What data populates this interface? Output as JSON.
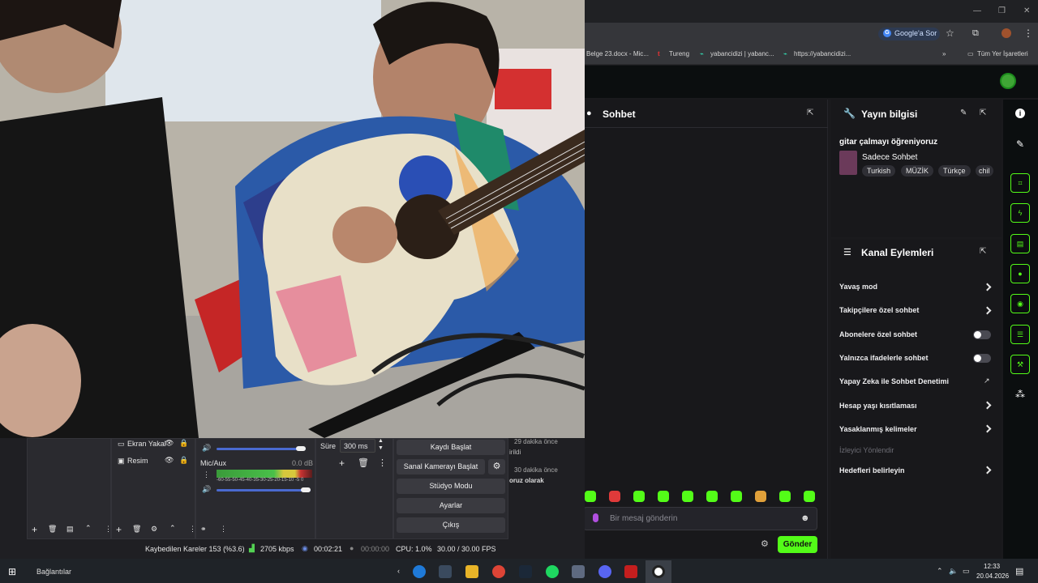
{
  "browser": {
    "google_pill": "Google'a Sor",
    "bookmarks": [
      {
        "label": "Belge 23.docx - Mic..."
      },
      {
        "label": "Tureng"
      },
      {
        "label": "yabancidizi | yabanc..."
      },
      {
        "label": "https://yabancidizi..."
      }
    ],
    "all_bookmarks": "Tüm Yer İşaretleri"
  },
  "chat": {
    "title": "Sohbet",
    "input_placeholder": "Bir mesaj gönderin",
    "send_label": "Gönder"
  },
  "stream_info": {
    "title": "Yayın bilgisi",
    "stream_title": "gitar çalmayı öğreniyoruz",
    "category": "Sadece Sohbet",
    "tags": [
      "Turkish",
      "MÜZİK",
      "Türkçe",
      "chil"
    ]
  },
  "channel_actions": {
    "title": "Kanal Eylemleri",
    "items": [
      {
        "label": "Yavaş mod",
        "control": "chevron"
      },
      {
        "label": "Takipçilere özel sohbet",
        "control": "chevron"
      },
      {
        "label": "Abonelere özel sohbet",
        "control": "toggle"
      },
      {
        "label": "Yalnızca ifadelerle sohbet",
        "control": "toggle"
      },
      {
        "label": "Yapay Zeka ile Sohbet Denetimi",
        "control": "external"
      },
      {
        "label": "Hesap yaşı kısıtlaması",
        "control": "chevron"
      },
      {
        "label": "Yasaklanmış kelimeler",
        "control": "chevron"
      }
    ],
    "section_label": "İzleyici Yönlendir",
    "goals": {
      "label": "Hedefleri belirleyin"
    }
  },
  "obs": {
    "sources": [
      {
        "label": "Ekran Yakal"
      },
      {
        "label": "Resim"
      }
    ],
    "audio": {
      "mic_label": "Mic/Aux",
      "mic_db": "0.0 dB",
      "scale": "-60-55-50-45-40-35-30-25-20-15-10 -5 0"
    },
    "transition": {
      "label": "Süre",
      "value": "300 ms"
    },
    "controls": [
      {
        "label": "Kaydı Başlat"
      },
      {
        "label": "Sanal Kamerayı Başlat"
      },
      {
        "label": "Stüdyo Modu"
      },
      {
        "label": "Ayarlar"
      },
      {
        "label": "Çıkış"
      }
    ],
    "log": [
      {
        "line1": "29 dakika önce",
        "line2": "irildi"
      },
      {
        "line1": "30 dakika önce",
        "line2": "oruz olarak"
      }
    ],
    "status": {
      "dropped": "Kaybedilen Kareler 153 (%3.6)",
      "bitrate": "2705 kbps",
      "stream_time": "00:02:21",
      "rec_time": "00:00:00",
      "cpu": "CPU: 1.0%",
      "fps": "30.00 / 30.00 FPS"
    }
  },
  "taskbar": {
    "search_label": "Bağlantılar",
    "time": "12:33",
    "date": "20.04.2026"
  },
  "colors": {
    "accent": "#53fc18",
    "panel": "#18181b"
  }
}
